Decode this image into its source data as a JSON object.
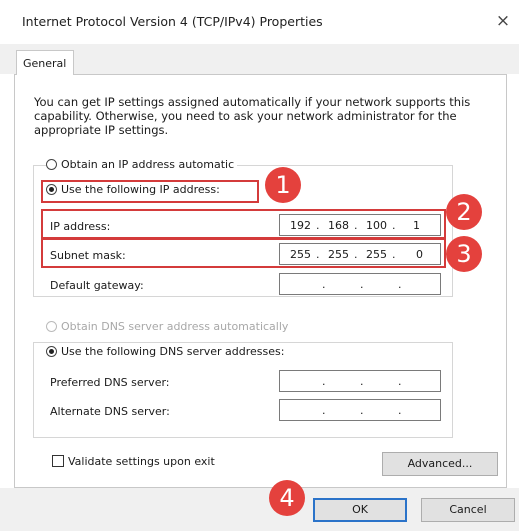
{
  "dialog": {
    "title": "Internet Protocol Version 4 (TCP/IPv4) Properties",
    "close_icon": "×"
  },
  "tabs": [
    {
      "label": "General"
    }
  ],
  "description": "You can get IP settings assigned automatically if your network supports this capability. Otherwise, you need to ask your network administrator for the appropriate IP settings.",
  "ip": {
    "auto_label": "Obtain an IP address automatic",
    "manual_label": "Use the following IP address:",
    "address_label": "IP address:",
    "address": [
      "192",
      "168",
      "100",
      "1"
    ],
    "mask_label": "Subnet mask:",
    "mask": [
      "255",
      "255",
      "255",
      "0"
    ],
    "gateway_label": "Default gateway:",
    "gateway": [
      "",
      "",
      "",
      ""
    ]
  },
  "dns": {
    "auto_label": "Obtain DNS server address automatically",
    "manual_label": "Use the following DNS server addresses:",
    "preferred_label": "Preferred DNS server:",
    "alternate_label": "Alternate DNS server:"
  },
  "validate_label": "Validate settings upon exit",
  "buttons": {
    "advanced": "Advanced...",
    "ok": "OK",
    "cancel": "Cancel"
  },
  "annotations": [
    "1",
    "2",
    "3",
    "4"
  ],
  "colors": {
    "highlight": "#d43b3b",
    "badge": "#e4413d",
    "ok_border": "#2b73c9"
  }
}
